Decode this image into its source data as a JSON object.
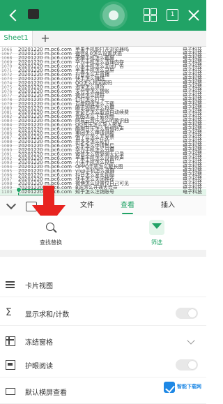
{
  "app": {
    "title": "",
    "accent_color": "#21a366"
  },
  "header": {
    "icons": [
      "back-arrow-icon",
      "file-thumbnail",
      "record-indicator",
      "multi-window-icon",
      "page-box-icon",
      "close-icon"
    ],
    "box_label": "1"
  },
  "sheets": {
    "tabs": [
      {
        "label": "Sheet1"
      }
    ],
    "add_label": "+"
  },
  "table": {
    "rows": [
      {
        "num": "1066",
        "date": "20201220",
        "site": "m.pc6.com",
        "title": "苹果手机能打开浏览器吗",
        "cat": "电子科技"
      },
      {
        "num": "1067",
        "date": "20201220",
        "site": "m.pc6.com",
        "title": "微信8.0怎么设置状态",
        "cat": "电子科技"
      },
      {
        "num": "1068",
        "date": "20201220",
        "site": "m.pc6.com",
        "title": "荣耀手机怎么截屏",
        "cat": "电子科技"
      },
      {
        "num": "1069",
        "date": "20201220",
        "site": "m.pc6.com",
        "title": "华为手机怎么清理内存",
        "cat": "电子科技"
      },
      {
        "num": "1070",
        "date": "20201220",
        "site": "m.pc6.com",
        "title": "小米手机怎么关闭广告",
        "cat": "电子科技"
      },
      {
        "num": "1071",
        "date": "20201220",
        "site": "m.pc6.com",
        "title": "苹果手机怎么录屏",
        "cat": "电子科技"
      },
      {
        "num": "1072",
        "date": "20201220",
        "site": "m.pc6.com",
        "title": "抖音怎么开直播",
        "cat": "电子科技"
      },
      {
        "num": "1073",
        "date": "20201220",
        "site": "m.pc6.com",
        "title": "快手怎么赚钱",
        "cat": "电子科技"
      },
      {
        "num": "1074",
        "date": "20201220",
        "site": "m.pc6.com",
        "title": "QQ怎么找回密码",
        "cat": "电子科技"
      },
      {
        "num": "1075",
        "date": "20201220",
        "site": "m.pc6.com",
        "title": "淘宝怎么退货",
        "cat": "电子科技"
      },
      {
        "num": "1076",
        "date": "20201220",
        "site": "m.pc6.com",
        "title": "支付宝怎么转账",
        "cat": "电子科技"
      },
      {
        "num": "1077",
        "date": "20201220",
        "site": "m.pc6.com",
        "title": "微信怎么建群",
        "cat": "电子科技"
      },
      {
        "num": "1078",
        "date": "20201220",
        "site": "m.pc6.com",
        "title": "钉钉怎么打卡",
        "cat": "电子科技"
      },
      {
        "num": "1079",
        "date": "20201220",
        "site": "m.pc6.com",
        "title": "百度网盘怎么下载",
        "cat": "电子科技"
      },
      {
        "num": "1080",
        "date": "20201220",
        "site": "m.pc6.com",
        "title": "腾讯视频怎么投屏",
        "cat": "电子科技"
      },
      {
        "num": "1081",
        "date": "20201220",
        "site": "m.pc6.com",
        "title": "爱奇艺怎么取消自动续费",
        "cat": "电子科技"
      },
      {
        "num": "1082",
        "date": "20201220",
        "site": "m.pc6.com",
        "title": "优酷怎么下载视频",
        "cat": "电子科技"
      },
      {
        "num": "1083",
        "date": "20201220",
        "site": "m.pc6.com",
        "title": "网易云音乐怎么听歌识曲",
        "cat": "电子科技"
      },
      {
        "num": "1084",
        "date": "20201220",
        "site": "m.pc6.com",
        "title": "QQ音乐怎么导入歌单",
        "cat": "电子科技"
      },
      {
        "num": "1085",
        "date": "20201220",
        "site": "m.pc6.com",
        "title": "酷狗音乐怎么剪辑铃声",
        "cat": "电子科技"
      },
      {
        "num": "1086",
        "date": "20201220",
        "site": "m.pc6.com",
        "title": "美团怎么申请退款",
        "cat": "电子科技"
      },
      {
        "num": "1087",
        "date": "20201220",
        "site": "m.pc6.com",
        "title": "饿了么怎么开发票",
        "cat": "电子科技"
      },
      {
        "num": "1088",
        "date": "20201220",
        "site": "m.pc6.com",
        "title": "拼多多怎么砍价",
        "cat": "电子科技"
      },
      {
        "num": "1089",
        "date": "20201220",
        "site": "m.pc6.com",
        "title": "京东怎么申请售后",
        "cat": "电子科技"
      },
      {
        "num": "1090",
        "date": "20201220",
        "site": "m.pc6.com",
        "title": "华为手机怎么分屏",
        "cat": "电子科技"
      },
      {
        "num": "1091",
        "date": "20201220",
        "site": "m.pc6.com",
        "title": "微信怎么恢复聊天记录",
        "cat": "电子科技"
      },
      {
        "num": "1092",
        "date": "20201220",
        "site": "m.pc6.com",
        "title": "苹果手机怎么设置铃声",
        "cat": "电子科技"
      },
      {
        "num": "1093",
        "date": "20201220",
        "site": "m.pc6.com",
        "title": "小米手机怎么投屏",
        "cat": "电子科技"
      },
      {
        "num": "1094",
        "date": "20201220",
        "site": "m.pc6.com",
        "title": "OPPO手机怎么截长图",
        "cat": "电子科技"
      },
      {
        "num": "1095",
        "date": "20201220",
        "site": "m.pc6.com",
        "title": "vivo手机怎么录屏",
        "cat": "电子科技"
      },
      {
        "num": "1096",
        "date": "20201220",
        "site": "m.pc6.com",
        "title": "抖音怎么发长视频",
        "cat": "电子科技"
      },
      {
        "num": "1097",
        "date": "20201220",
        "site": "m.pc6.com",
        "title": "快手怎么关闭推荐",
        "cat": "电子科技"
      },
      {
        "num": "1098",
        "date": "20201220",
        "site": "m.pc6.com",
        "title": "微博怎么设置仅自己可见",
        "cat": "电子科技"
      },
      {
        "num": "1099",
        "date": "20201220",
        "site": "m.pc6.com",
        "title": "B站怎么开通大会员",
        "cat": "电子科技"
      },
      {
        "num": "1100",
        "date": "20201220",
        "site": "m.pc6.com",
        "title": "知乎怎么注销账号",
        "cat": "电子科技"
      }
    ],
    "selected_row_index": 34
  },
  "toolbar": {
    "tabs": [
      {
        "label": "文件",
        "active": false
      },
      {
        "label": "查看",
        "active": true
      },
      {
        "label": "插入",
        "active": false
      }
    ]
  },
  "quick_tools": {
    "find_label": "查找替换",
    "filter_label": "筛选"
  },
  "menu": {
    "card_view": "卡片视图",
    "show_sum": "显示求和/计数",
    "freeze": "冻结窗格",
    "reading_mode": "护眼阅读",
    "landscape": "默认横屏查看",
    "show_sum_on": false,
    "reading_mode_on": false
  },
  "watermark": {
    "text": "智能下载网"
  }
}
